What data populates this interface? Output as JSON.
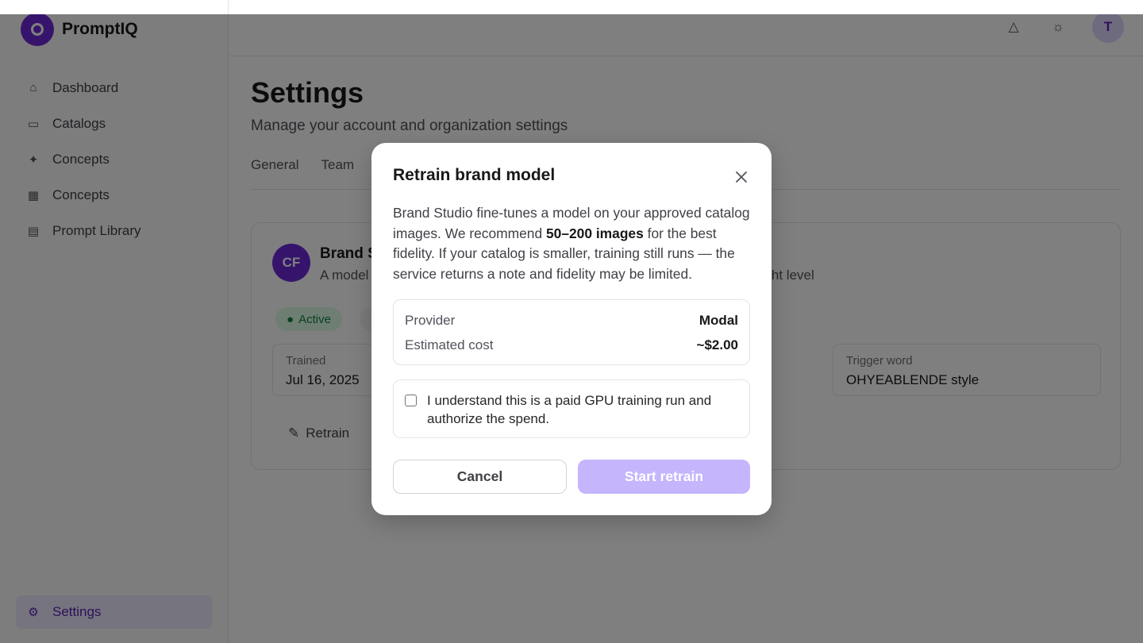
{
  "app": {
    "name": "PromptIQ",
    "avatar_initial": "T"
  },
  "sidebar": {
    "items": [
      {
        "label": "Dashboard",
        "icon": "home-icon"
      },
      {
        "label": "Catalogs",
        "icon": "folder-icon"
      },
      {
        "label": "Concepts",
        "icon": "sparkle-icon"
      },
      {
        "label": "Concepts",
        "icon": "grid-icon"
      },
      {
        "label": "Prompt Library",
        "icon": "book-icon"
      }
    ],
    "bottom": {
      "label": "Settings",
      "icon": "gear-icon"
    }
  },
  "page": {
    "title": "Settings",
    "subtitle": "Manage your account and organization settings",
    "tabs": [
      "General",
      "Team"
    ]
  },
  "card": {
    "avatar": "CF",
    "title": "Brand Studio",
    "description": "A model fine-tuned",
    "description_right": "right level",
    "badge": "Active",
    "stat_trained_label": "Trained",
    "stat_trained_value": "Jul 16, 2025",
    "stat_trigger_label": "Trigger word",
    "stat_trigger_value": "OHYEABLENDE style",
    "retrain_label": "Retrain"
  },
  "modal": {
    "title": "Retrain brand model",
    "desc_part1": "Brand Studio fine-tunes a model on your approved catalog images. We recommend ",
    "desc_bold": "50–200 images",
    "desc_part2": " for the best fidelity. If your catalog is smaller, training still runs — the service returns a note and fidelity may be limited.",
    "provider_label": "Provider",
    "provider_value": "Modal",
    "cost_label": "Estimated cost",
    "cost_value": "~$2.00",
    "consent_text": "I understand this is a paid GPU training run and authorize the spend.",
    "consent_checked": false,
    "cancel_label": "Cancel",
    "start_label": "Start retrain"
  }
}
